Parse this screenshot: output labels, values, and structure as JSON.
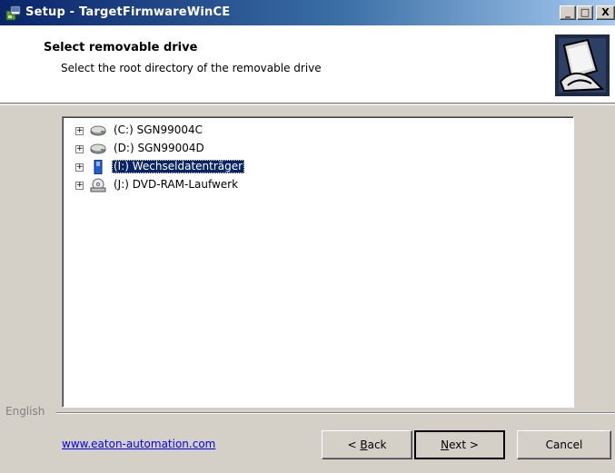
{
  "window": {
    "title": "Setup - TargetFirmwareWinCE",
    "controls": {
      "minimize": "_",
      "maximize": "□",
      "close": "X"
    }
  },
  "header": {
    "title": "Select removable drive",
    "subtitle": "Select the root directory of the removable drive"
  },
  "tree": {
    "items": [
      {
        "label": "(C:) SGN99004C",
        "icon": "hard-drive-icon",
        "expander": "+"
      },
      {
        "label": "(D:) SGN99004D",
        "icon": "hard-drive-icon",
        "expander": "+"
      },
      {
        "label": "(I:) Wechseldatenträger",
        "icon": "removable-drive-icon",
        "expander": "+",
        "selected": true
      },
      {
        "label": "(J:) DVD-RAM-Laufwerk",
        "icon": "dvd-drive-icon",
        "expander": "+"
      }
    ]
  },
  "footer": {
    "language": "English",
    "link": "www.eaton-automation.com",
    "back_prefix": "< ",
    "back_key": "B",
    "back_rest": "ack",
    "next_key": "N",
    "next_rest": "ext >",
    "cancel": "Cancel"
  },
  "colors": {
    "title_bar_start": "#0a246a",
    "selection": "#0a246a",
    "link": "#0000ff",
    "face": "#d4d0c8"
  }
}
